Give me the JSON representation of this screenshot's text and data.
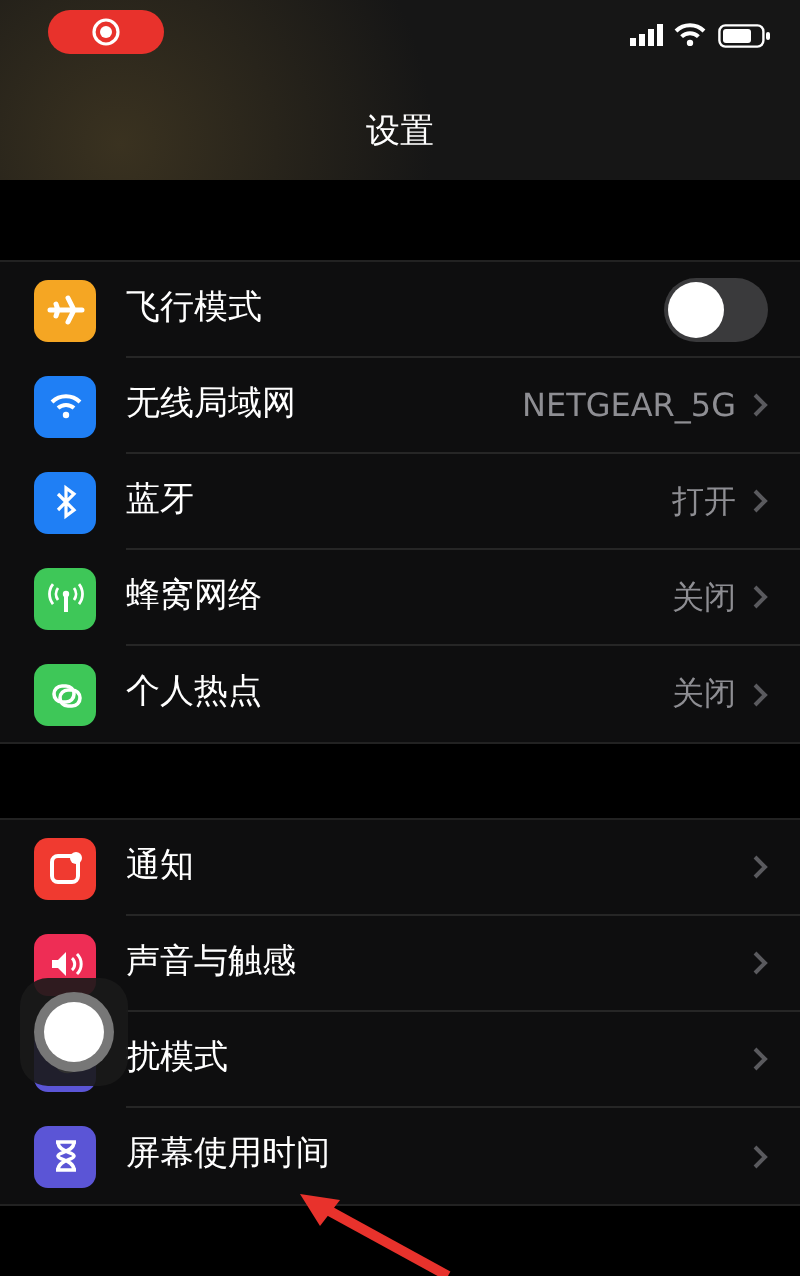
{
  "title": "设置",
  "groups": [
    {
      "rows": [
        {
          "kind": "toggle",
          "label": "飞行模式",
          "on": false,
          "color": "#f5a623"
        },
        {
          "kind": "link",
          "label": "无线局域网",
          "value": "NETGEAR_5G",
          "color": "#1f7ff5"
        },
        {
          "kind": "link",
          "label": "蓝牙",
          "value": "打开",
          "color": "#1f7ff5"
        },
        {
          "kind": "link",
          "label": "蜂窝网络",
          "value": "关闭",
          "color": "#3ec758"
        },
        {
          "kind": "link",
          "label": "个人热点",
          "value": "关闭",
          "color": "#3ec758"
        }
      ]
    },
    {
      "rows": [
        {
          "kind": "link",
          "label": "通知",
          "color": "#f03a30"
        },
        {
          "kind": "link",
          "label": "声音与触感",
          "color": "#ee2d55"
        },
        {
          "kind": "link",
          "label": "扰模式",
          "color": "#5b55d6"
        },
        {
          "kind": "link",
          "label": "屏幕使用时间",
          "color": "#5b55d6"
        }
      ]
    }
  ]
}
